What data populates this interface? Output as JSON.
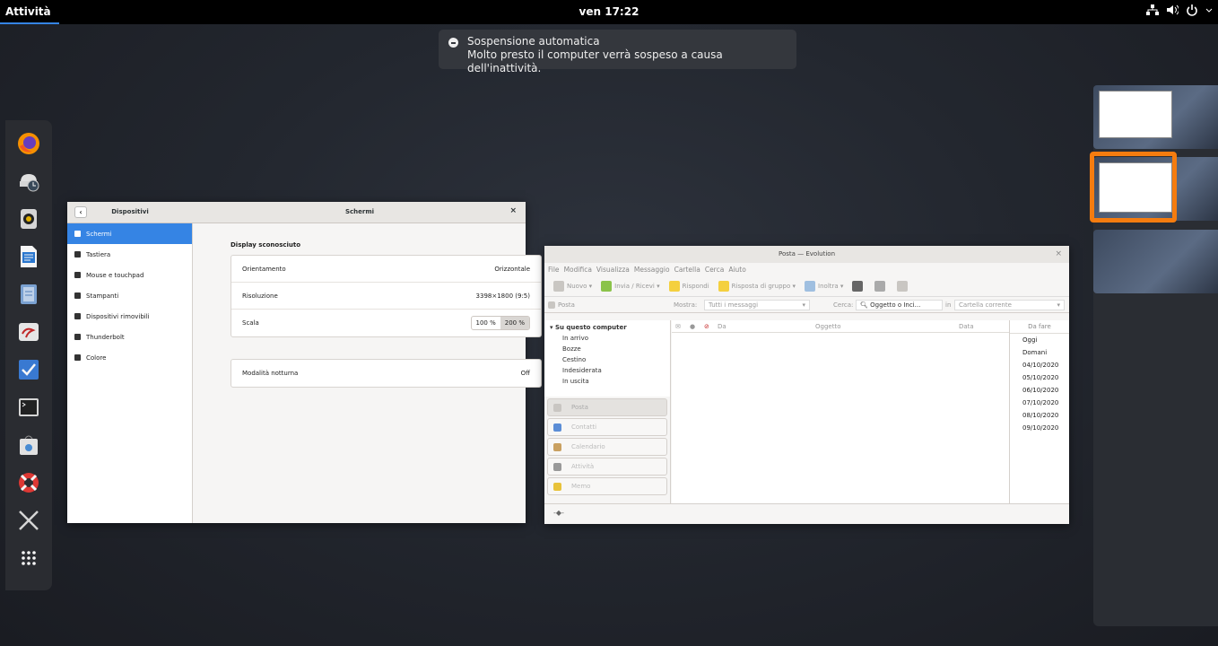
{
  "topbar": {
    "activities": "Attività",
    "clock": "ven 17:22"
  },
  "notification": {
    "title": "Sospensione automatica",
    "body": "Molto presto il computer verrà sospeso a causa dell'inattività."
  },
  "dash": {
    "apps": [
      "firefox-icon",
      "clock-icon",
      "speaker-icon",
      "writer-icon",
      "files-icon",
      "evolution-icon",
      "tasks-icon",
      "terminal-icon",
      "software-icon",
      "help-icon",
      "utilities-icon",
      "app-grid-icon"
    ]
  },
  "settings": {
    "sidebar_title": "Dispositivi",
    "title": "Schermi",
    "items": [
      {
        "label": "Schermi",
        "selected": true
      },
      {
        "label": "Tastiera"
      },
      {
        "label": "Mouse e touchpad"
      },
      {
        "label": "Stampanti"
      },
      {
        "label": "Dispositivi rimovibili"
      },
      {
        "label": "Thunderbolt"
      },
      {
        "label": "Colore"
      }
    ],
    "section_title": "Display sconosciuto",
    "orientation_label": "Orientamento",
    "orientation_value": "Orizzontale",
    "resolution_label": "Risoluzione",
    "resolution_value": "3398×1800 (9:5)",
    "scale_label": "Scala",
    "scale_100": "100 %",
    "scale_200": "200 %",
    "night_label": "Modalità notturna",
    "night_value": "Off"
  },
  "evolution": {
    "title": "Posta — Evolution",
    "menu": [
      "File",
      "Modifica",
      "Visualizza",
      "Messaggio",
      "Cartella",
      "Cerca",
      "Aiuto"
    ],
    "toolbar": {
      "new": "Nuovo",
      "send_receive": "Invia / Ricevi",
      "reply": "Rispondi",
      "reply_group": "Risposta di gruppo",
      "forward": "Inoltra"
    },
    "folder_header": "Posta",
    "show_label": "Mostra:",
    "show_value": "Tutti i messaggi",
    "search_label": "Cerca:",
    "search_value": "Oggetto o Inci...",
    "in_label": "in",
    "in_value": "Cartella corrente",
    "tree_root": "Su questo computer",
    "folders": [
      "In arrivo",
      "Bozze",
      "Cestino",
      "Indesiderata",
      "In uscita"
    ],
    "list_headers": {
      "from": "Da",
      "subject": "Oggetto",
      "date": "Data"
    },
    "switcher": [
      "Posta",
      "Contatti",
      "Calendario",
      "Attività",
      "Memo"
    ],
    "todo_header": "Da fare",
    "todo": [
      "Oggi",
      "Domani",
      "04/10/2020",
      "05/10/2020",
      "06/10/2020",
      "07/10/2020",
      "08/10/2020",
      "09/10/2020"
    ]
  }
}
